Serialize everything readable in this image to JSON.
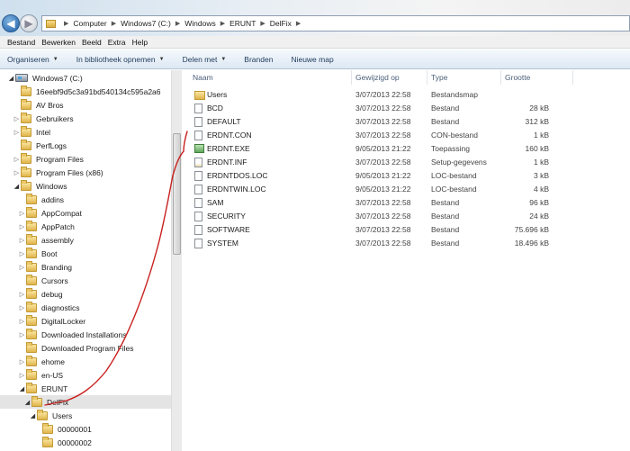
{
  "address": {
    "crumbs": [
      "Computer",
      "Windows7 (C:)",
      "Windows",
      "ERUNT",
      "DelFix"
    ]
  },
  "menu": [
    "Bestand",
    "Bewerken",
    "Beeld",
    "Extra",
    "Help"
  ],
  "toolbar": {
    "organize": "Organiseren",
    "library": "In bibliotheek opnemen",
    "share": "Delen met",
    "burn": "Branden",
    "new_folder": "Nieuwe map"
  },
  "tree": [
    {
      "label": "Windows7 (C:)",
      "depth": 0,
      "arrow": "open",
      "icon": "drive"
    },
    {
      "label": "16eebf9d5c3a91bd540134c595a2a6",
      "depth": 1,
      "arrow": "",
      "icon": "folder"
    },
    {
      "label": "AV Bros",
      "depth": 1,
      "arrow": "",
      "icon": "folder"
    },
    {
      "label": "Gebruikers",
      "depth": 1,
      "arrow": "closed",
      "icon": "folder"
    },
    {
      "label": "Intel",
      "depth": 1,
      "arrow": "closed",
      "icon": "folder"
    },
    {
      "label": "PerfLogs",
      "depth": 1,
      "arrow": "",
      "icon": "folder"
    },
    {
      "label": "Program Files",
      "depth": 1,
      "arrow": "closed",
      "icon": "folder"
    },
    {
      "label": "Program Files (x86)",
      "depth": 1,
      "arrow": "closed",
      "icon": "folder"
    },
    {
      "label": "Windows",
      "depth": 1,
      "arrow": "open",
      "icon": "folder"
    },
    {
      "label": "addins",
      "depth": 2,
      "arrow": "",
      "icon": "folder"
    },
    {
      "label": "AppCompat",
      "depth": 2,
      "arrow": "closed",
      "icon": "folder"
    },
    {
      "label": "AppPatch",
      "depth": 2,
      "arrow": "closed",
      "icon": "folder"
    },
    {
      "label": "assembly",
      "depth": 2,
      "arrow": "closed",
      "icon": "folder"
    },
    {
      "label": "Boot",
      "depth": 2,
      "arrow": "closed",
      "icon": "folder"
    },
    {
      "label": "Branding",
      "depth": 2,
      "arrow": "closed",
      "icon": "folder"
    },
    {
      "label": "Cursors",
      "depth": 2,
      "arrow": "",
      "icon": "folder"
    },
    {
      "label": "debug",
      "depth": 2,
      "arrow": "closed",
      "icon": "folder"
    },
    {
      "label": "diagnostics",
      "depth": 2,
      "arrow": "closed",
      "icon": "folder"
    },
    {
      "label": "DigitalLocker",
      "depth": 2,
      "arrow": "closed",
      "icon": "folder"
    },
    {
      "label": "Downloaded Installations",
      "depth": 2,
      "arrow": "closed",
      "icon": "folder"
    },
    {
      "label": "Downloaded Program Files",
      "depth": 2,
      "arrow": "",
      "icon": "folder"
    },
    {
      "label": "ehome",
      "depth": 2,
      "arrow": "closed",
      "icon": "folder"
    },
    {
      "label": "en-US",
      "depth": 2,
      "arrow": "closed",
      "icon": "folder"
    },
    {
      "label": "ERUNT",
      "depth": 2,
      "arrow": "open",
      "icon": "folder"
    },
    {
      "label": "DelFix",
      "depth": 3,
      "arrow": "open",
      "icon": "folder",
      "selected": true
    },
    {
      "label": "Users",
      "depth": 4,
      "arrow": "open",
      "icon": "folder"
    },
    {
      "label": "00000001",
      "depth": 5,
      "arrow": "",
      "icon": "folder"
    },
    {
      "label": "00000002",
      "depth": 5,
      "arrow": "",
      "icon": "folder"
    }
  ],
  "columns": {
    "name": "Naam",
    "date": "Gewijzigd op",
    "type": "Type",
    "size": "Grootte"
  },
  "files": [
    {
      "name": "Users",
      "date": "3/07/2013 22:58",
      "type": "Bestandsmap",
      "size": "",
      "icon": "folder"
    },
    {
      "name": "BCD",
      "date": "3/07/2013 22:58",
      "type": "Bestand",
      "size": "28 kB",
      "icon": "file"
    },
    {
      "name": "DEFAULT",
      "date": "3/07/2013 22:58",
      "type": "Bestand",
      "size": "312 kB",
      "icon": "file"
    },
    {
      "name": "ERDNT.CON",
      "date": "3/07/2013 22:58",
      "type": "CON-bestand",
      "size": "1 kB",
      "icon": "file"
    },
    {
      "name": "ERDNT.EXE",
      "date": "9/05/2013 21:22",
      "type": "Toepassing",
      "size": "160 kB",
      "icon": "exe"
    },
    {
      "name": "ERDNT.INF",
      "date": "3/07/2013 22:58",
      "type": "Setup-gegevens",
      "size": "1 kB",
      "icon": "inf"
    },
    {
      "name": "ERDNTDOS.LOC",
      "date": "9/05/2013 21:22",
      "type": "LOC-bestand",
      "size": "3 kB",
      "icon": "file"
    },
    {
      "name": "ERDNTWIN.LOC",
      "date": "9/05/2013 21:22",
      "type": "LOC-bestand",
      "size": "4 kB",
      "icon": "file"
    },
    {
      "name": "SAM",
      "date": "3/07/2013 22:58",
      "type": "Bestand",
      "size": "96 kB",
      "icon": "file"
    },
    {
      "name": "SECURITY",
      "date": "3/07/2013 22:58",
      "type": "Bestand",
      "size": "24 kB",
      "icon": "file"
    },
    {
      "name": "SOFTWARE",
      "date": "3/07/2013 22:58",
      "type": "Bestand",
      "size": "75.696 kB",
      "icon": "file"
    },
    {
      "name": "SYSTEM",
      "date": "3/07/2013 22:58",
      "type": "Bestand",
      "size": "18.496 kB",
      "icon": "file"
    }
  ],
  "annotation_color": "#c8201e"
}
